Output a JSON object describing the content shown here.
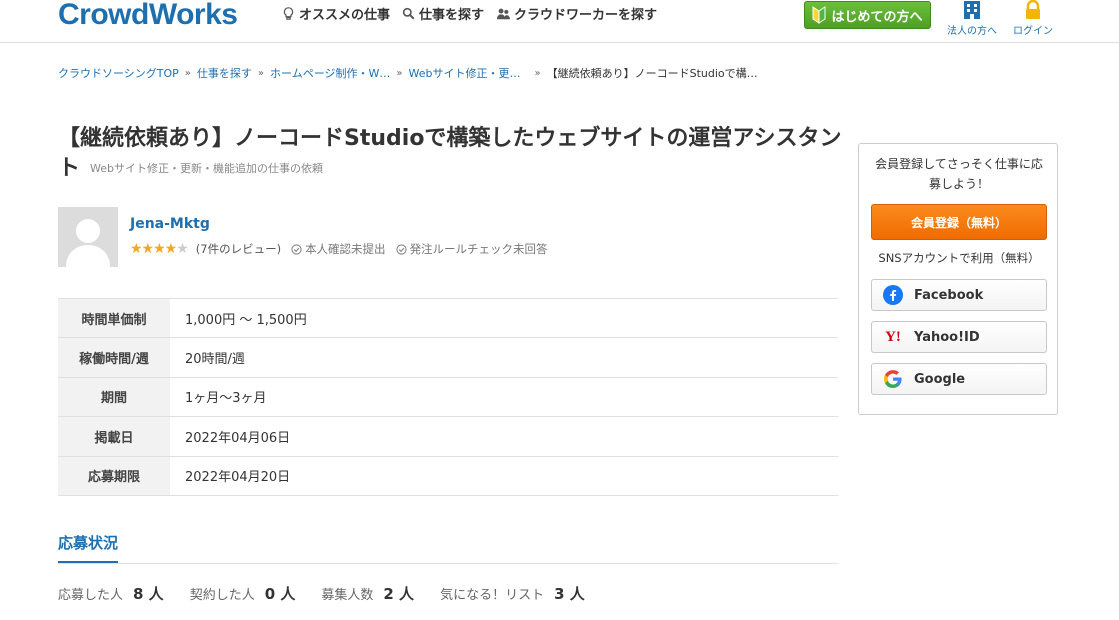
{
  "header": {
    "logo": "CrowdWorks",
    "nav": [
      {
        "label": "オススメの仕事"
      },
      {
        "label": "仕事を探す"
      },
      {
        "label": "クラウドワーカーを探す"
      }
    ],
    "beginner_label": "はじめての方へ",
    "corporate_label": "法人の方へ",
    "login_label": "ログイン"
  },
  "breadcrumb": [
    "クラウドソーシングTOP",
    "仕事を探す",
    "ホームページ制作・W…",
    "Webサイト修正・更…",
    "【継続依頼あり】ノーコードStudioで構…"
  ],
  "job": {
    "title": "【継続依頼あり】ノーコードStudioで構築したウェブサイトの運営アシスタント",
    "category": "Webサイト修正・更新・機能追加の仕事の依頼"
  },
  "client": {
    "name": "Jena-Mktg",
    "rating": 4.5,
    "reviews": "(7件のレビュー)",
    "identity": "本人確認未提出",
    "rule_check": "発注ルールチェック未回答"
  },
  "details": [
    {
      "label": "時間単価制",
      "value": "1,000円 〜 1,500円"
    },
    {
      "label": "稼働時間/週",
      "value": "20時間/週"
    },
    {
      "label": "期間",
      "value": "1ヶ月〜3ヶ月"
    },
    {
      "label": "掲載日",
      "value": "2022年04月06日"
    },
    {
      "label": "応募期限",
      "value": "2022年04月20日"
    }
  ],
  "status": {
    "tab_label": "応募状況",
    "items": [
      {
        "label": "応募した人",
        "value": "8 人"
      },
      {
        "label": "契約した人",
        "value": "0 人"
      },
      {
        "label": "募集人数",
        "value": "2 人"
      },
      {
        "label": "気になる！リスト",
        "value": "3 人"
      }
    ]
  },
  "sidebar": {
    "lead": "会員登録してさっそく仕事に応募しよう！",
    "register_label": "会員登録（無料）",
    "sns_lead": "SNSアカウントで利用（無料）",
    "sns": [
      {
        "label": "Facebook"
      },
      {
        "label": "Yahoo!ID"
      },
      {
        "label": "Google"
      }
    ]
  },
  "colors": {
    "brand": "#1d6fb0",
    "register": "#f57c00",
    "beginner": "#5aa92c"
  }
}
